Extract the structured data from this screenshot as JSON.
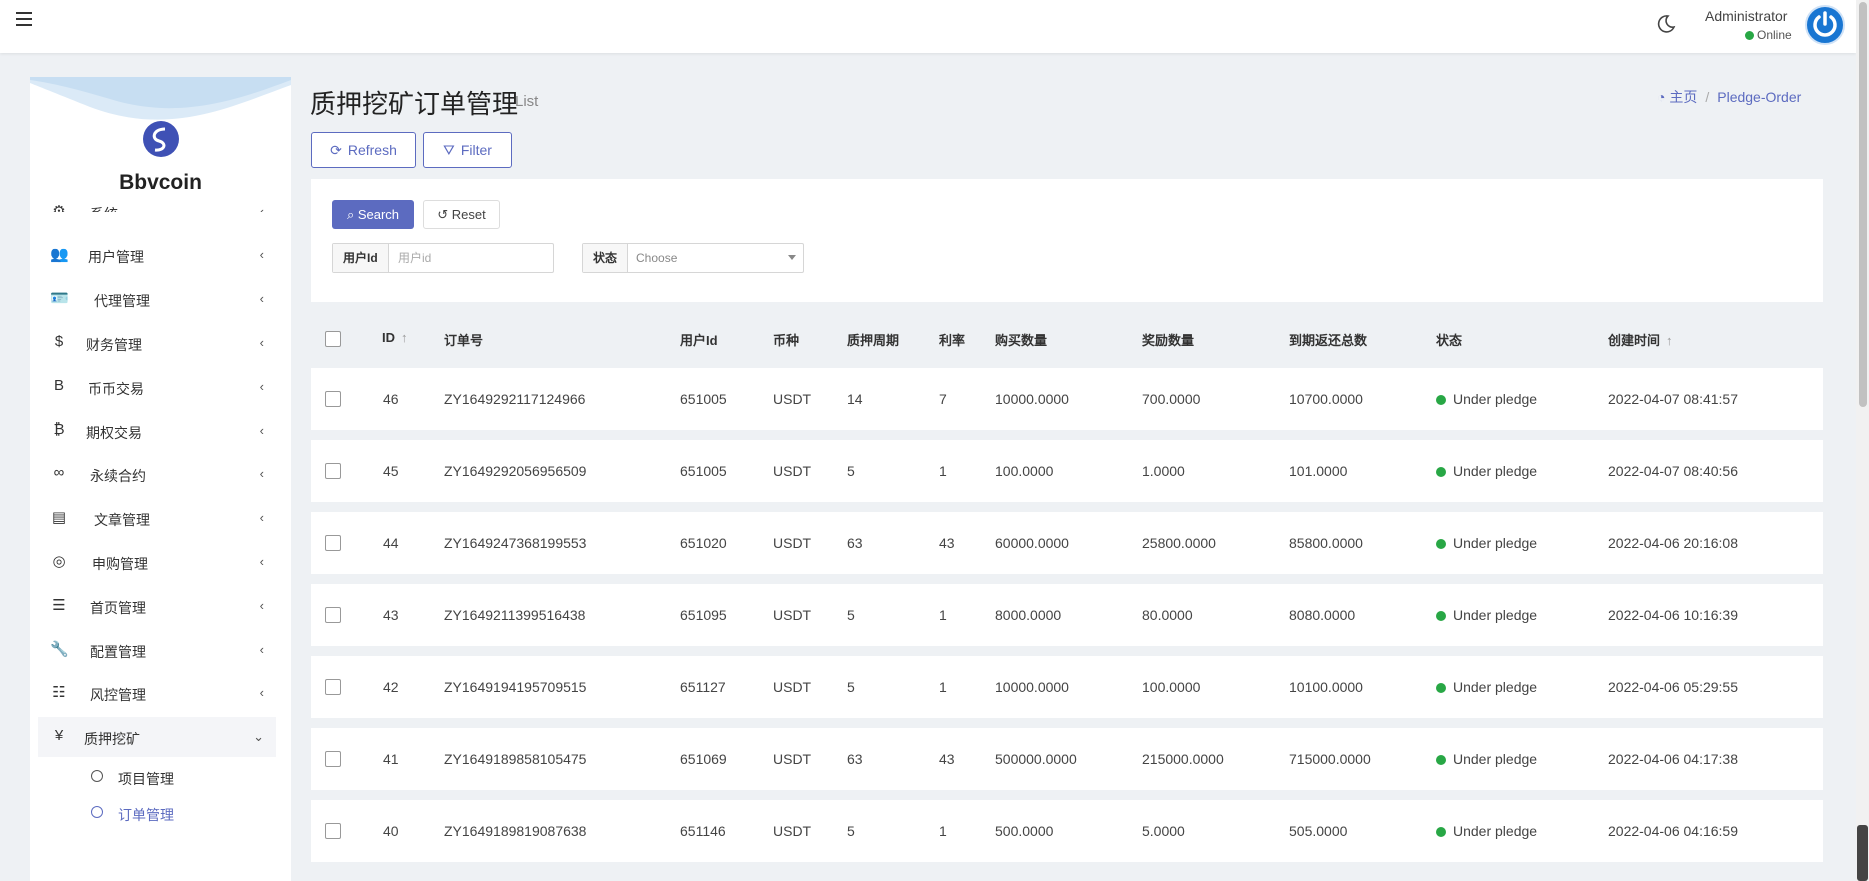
{
  "user": {
    "name": "Administrator",
    "status": "Online"
  },
  "brand": "Bbvcoin",
  "sidebar": {
    "items": [
      {
        "label": "系统",
        "icon": "gear-icon",
        "glyph": "⚙",
        "expanded": false
      },
      {
        "label": "用户管理",
        "icon": "users-icon",
        "glyph": "👥",
        "expanded": false
      },
      {
        "label": "代理管理",
        "icon": "id-card-icon",
        "glyph": "🪪",
        "expanded": false
      },
      {
        "label": "财务管理",
        "icon": "dollar-icon",
        "glyph": "$",
        "expanded": false
      },
      {
        "label": "币币交易",
        "icon": "bold-b-icon",
        "glyph": "B",
        "expanded": false
      },
      {
        "label": "期权交易",
        "icon": "bitcoin-icon",
        "glyph": "₿",
        "expanded": false
      },
      {
        "label": "永续合约",
        "icon": "link-icon",
        "glyph": "∞",
        "expanded": false
      },
      {
        "label": "文章管理",
        "icon": "newspaper-icon",
        "glyph": "▤",
        "expanded": false
      },
      {
        "label": "申购管理",
        "icon": "lifebuoy-icon",
        "glyph": "◎",
        "expanded": false
      },
      {
        "label": "首页管理",
        "icon": "list-icon",
        "glyph": "☰",
        "expanded": false
      },
      {
        "label": "配置管理",
        "icon": "wrench-icon",
        "glyph": "🔧",
        "expanded": false
      },
      {
        "label": "风控管理",
        "icon": "indent-icon",
        "glyph": "☷",
        "expanded": false
      },
      {
        "label": "质押挖矿",
        "icon": "yen-icon",
        "glyph": "¥",
        "expanded": true
      }
    ],
    "subitems": [
      {
        "label": "项目管理",
        "current": false
      },
      {
        "label": "订单管理",
        "current": true
      }
    ]
  },
  "page": {
    "title": "质押挖矿订单管理",
    "subtitle": "List"
  },
  "breadcrumb": {
    "home": "主页",
    "current": "Pledge-Order"
  },
  "toolbar": {
    "refresh": "Refresh",
    "filter": "Filter"
  },
  "filter": {
    "search": "Search",
    "reset": "Reset",
    "user_id_label": "用户Id",
    "user_id_placeholder": "用户id",
    "user_id_value": "",
    "status_label": "状态",
    "status_value": "Choose"
  },
  "table": {
    "columns": [
      "ID",
      "订单号",
      "用户Id",
      "币种",
      "质押周期",
      "利率",
      "购买数量",
      "奖励数量",
      "到期返还总数",
      "状态",
      "创建时间"
    ],
    "rows": [
      [
        "46",
        "ZY1649292117124966",
        "651005",
        "USDT",
        "14",
        "7",
        "10000.0000",
        "700.0000",
        "10700.0000",
        "Under pledge",
        "2022-04-07 08:41:57"
      ],
      [
        "45",
        "ZY1649292056956509",
        "651005",
        "USDT",
        "5",
        "1",
        "100.0000",
        "1.0000",
        "101.0000",
        "Under pledge",
        "2022-04-07 08:40:56"
      ],
      [
        "44",
        "ZY1649247368199553",
        "651020",
        "USDT",
        "63",
        "43",
        "60000.0000",
        "25800.0000",
        "85800.0000",
        "Under pledge",
        "2022-04-06 20:16:08"
      ],
      [
        "43",
        "ZY1649211399516438",
        "651095",
        "USDT",
        "5",
        "1",
        "8000.0000",
        "80.0000",
        "8080.0000",
        "Under pledge",
        "2022-04-06 10:16:39"
      ],
      [
        "42",
        "ZY1649194195709515",
        "651127",
        "USDT",
        "5",
        "1",
        "10000.0000",
        "100.0000",
        "10100.0000",
        "Under pledge",
        "2022-04-06 05:29:55"
      ],
      [
        "41",
        "ZY1649189858105475",
        "651069",
        "USDT",
        "63",
        "43",
        "500000.0000",
        "215000.0000",
        "715000.0000",
        "Under pledge",
        "2022-04-06 04:17:38"
      ],
      [
        "40",
        "ZY1649189819087638",
        "651146",
        "USDT",
        "5",
        "1",
        "500.0000",
        "5.0000",
        "505.0000",
        "Under pledge",
        "2022-04-06 04:16:59"
      ]
    ]
  },
  "colors": {
    "accent": "#5c6bc0",
    "status_green": "#28a745"
  }
}
